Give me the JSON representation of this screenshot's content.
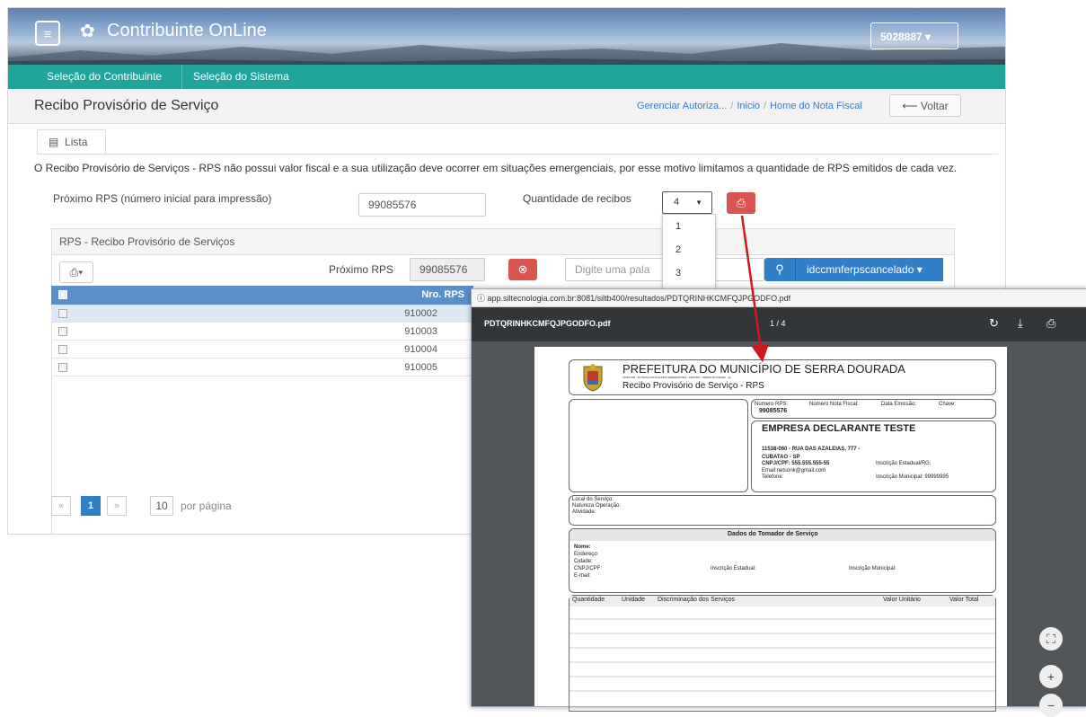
{
  "app": {
    "title": "Contribuinte OnLine",
    "user_button": "5028887 ▾",
    "nav": [
      "Seleção do Contribuinte",
      "Seleção do Sistema"
    ],
    "page_title": "Recibo Provisório de Serviço",
    "breadcrumb": [
      "Gerenciar Autoriza...",
      "Inicio",
      "Home do Nota Fiscal"
    ],
    "back_label": "Voltar",
    "tab_label": "Lista",
    "notice": "O Recibo Provisório de Serviços - RPS não possui valor fiscal e a sua utilização deve ocorrer em situações emergenciais, por esse motivo limitamos a quantidade de RPS emitidos de cada vez.",
    "proximo_label": "Próximo RPS (número inicial para impressão)",
    "proximo_value": "99085576",
    "quantidade_label": "Quantidade de recibos",
    "quantidade_value": "4",
    "quantidade_options": [
      "1",
      "2",
      "3"
    ],
    "panel_title": "RPS - Recibo Provisório de Serviços",
    "proximo_rps_label": "Próximo RPS",
    "proximo_rps_value": "99085576",
    "search_placeholder": "Digite uma pala",
    "filter_label": "idccmnferpscancelado ▾",
    "table_header": "Nro. RPS",
    "rows": [
      "910002",
      "910003",
      "910004",
      "910005"
    ],
    "pager": {
      "first": "«",
      "page": "1",
      "next": "»",
      "per_page": "10",
      "per_page_label": "por página"
    }
  },
  "pdf": {
    "url": "app.siltecnologia.com.br:8081/siltb400/resultados/PDTQRINHKCMFQJPGODFO.pdf",
    "filename": "PDTQRINHKCMFQJPGODFO.pdf",
    "page_indicator": "1 / 4",
    "header_title": "PREFEITURA DO MUNICÍPIO DE SERRA DOURADA",
    "header_sub": "11510-036 - AV PRAÇA DOS ALPES VEREDIANTES - CENTRO - SERRA DOURADA - sp",
    "doc_title": "Recibo Provisório de Serviço - RPS",
    "numero_rps_label": "Número RPS:",
    "numero_rps_value": "99085576",
    "nota_label": "Número Nota Fiscal:",
    "emissao_label": "Data Emissão:",
    "chave_label": "Chave:",
    "empresa": "EMPRESA DECLARANTE TESTE",
    "endereco": "11538-060 - RUA DAS AZALEIAS, 777 -",
    "cidade": "CUBATAO - SP",
    "cnpj": "CNPJ/CPF: 555.555.555-55",
    "email": "Email:netsonk@gmail.com",
    "telefone": "Telefone:",
    "insc_estadual": "Inscrição Estadual/RG:",
    "insc_municipal": "Inscrição Municipal: 99999995",
    "local_servico": "Local do Serviço:",
    "natureza": "Natureza Operação:",
    "atividade": "Atividade:",
    "tomador_title": "Dados do Tomador de Serviço",
    "tomador_nome": "Nome:",
    "tomador_endereco": "Endereço:",
    "tomador_cidade": "Cidade:",
    "tomador_cnpj": "CNPJ/CPF:",
    "tomador_email": "E-mail:",
    "tomador_estadual": "Inscrição Estadual:",
    "tomador_municipal": "Inscrição Municipal:",
    "servicos_headers": [
      "Quantidade",
      "Unidade",
      "Discriminação dos Serviços",
      "Valor Unitário",
      "Valor Total"
    ]
  },
  "colors": {
    "teal": "#1fa59a",
    "blue": "#2f7fc9",
    "red": "#d9534f",
    "arrow": "#d0171e",
    "pdf_toolbar": "#323639"
  },
  "icons": [
    "menu-icon",
    "gear-icon",
    "list-icon",
    "print-icon",
    "cancel-icon",
    "search-icon",
    "rotate-icon",
    "download-icon",
    "fit-page-icon",
    "zoom-in-icon",
    "zoom-out-icon"
  ]
}
